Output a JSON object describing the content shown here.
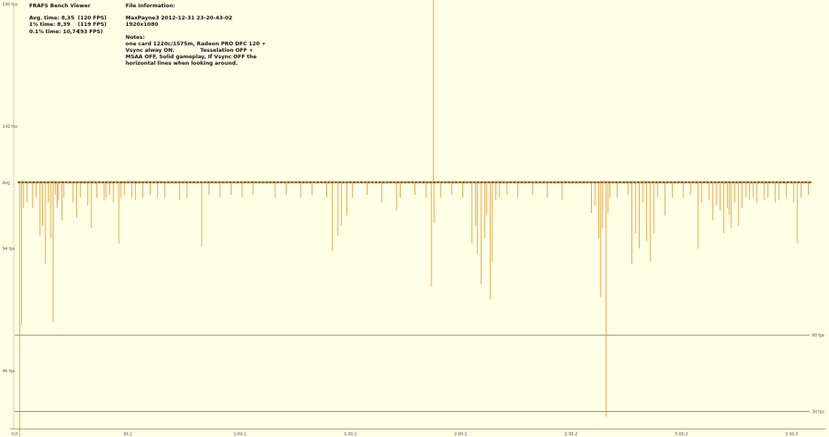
{
  "app": {
    "title": "FRAFS Bench Viewer",
    "stats": [
      {
        "label": "Avg. time: 8,35",
        "fps": "(120 FPS)"
      },
      {
        "label": "1% time: 8,39",
        "fps": "(119 FPS)"
      },
      {
        "label": "0.1% time: 10,74",
        "fps": "(93 FPS)"
      }
    ]
  },
  "file_info": {
    "heading": "File Information:",
    "name": "MaxPayne3 2012-12-31 23-20-43-02",
    "resolution": "1920x1080",
    "notes_heading": "Notes:",
    "notes_lines": [
      "one card 1220c/1575m, Radeon PRO DFC 120 +",
      "Vsync alway ON.              Tesselation OFF +",
      "MSAA OFF, Solid gameplay, If Vsync OFF the",
      "horizontal lines when looking around."
    ]
  },
  "colors": {
    "background": "#ffffe6",
    "trace": "#e8a23a",
    "line": "#6b6046",
    "avg": "#2b2b2b"
  },
  "chart_data": {
    "type": "line",
    "title": "",
    "xlabel": "",
    "ylabel": "",
    "ylim": [
      20,
      190
    ],
    "xlim": [
      0,
      216
    ],
    "y_tick_labels": [
      {
        "value": 190,
        "label": "190 fps"
      },
      {
        "value": 142,
        "label": "142 fps"
      },
      {
        "value": 120,
        "label": "Avg."
      },
      {
        "value": 94,
        "label": "94 fps"
      },
      {
        "value": 46,
        "label": "46 fps"
      }
    ],
    "x_tick_labels": [
      {
        "value": 0,
        "label": "0,0"
      },
      {
        "value": 30,
        "label": "30,1"
      },
      {
        "value": 60,
        "label": "1:00,1"
      },
      {
        "value": 90,
        "label": "1:30,1"
      },
      {
        "value": 120,
        "label": "2:00,1"
      },
      {
        "value": 150,
        "label": "2:30,2"
      },
      {
        "value": 180,
        "label": "3:00,3"
      },
      {
        "value": 210,
        "label": "3:30,3"
      }
    ],
    "reference_lines": [
      {
        "value": 60,
        "label": "60 fps"
      },
      {
        "value": 30,
        "label": "30 fps"
      }
    ],
    "series": [
      {
        "baseline": 120,
        "dips": [
          [
            0.5,
            18
          ],
          [
            1.0,
            64
          ],
          [
            1.5,
            110
          ],
          [
            2.5,
            112
          ],
          [
            4.0,
            110
          ],
          [
            5.0,
            114
          ],
          [
            6.0,
            99
          ],
          [
            6.7,
            103
          ],
          [
            7.5,
            88
          ],
          [
            8.3,
            112
          ],
          [
            9.0,
            98
          ],
          [
            9.6,
            65
          ],
          [
            10.2,
            115
          ],
          [
            10.7,
            110
          ],
          [
            11.0,
            113
          ],
          [
            12.0,
            105
          ],
          [
            12.5,
            114
          ],
          [
            15.0,
            112
          ],
          [
            16.0,
            106
          ],
          [
            17.0,
            114
          ],
          [
            19.0,
            111
          ],
          [
            20.0,
            102
          ],
          [
            21.5,
            114
          ],
          [
            23.5,
            113
          ],
          [
            24.0,
            114
          ],
          [
            25.0,
            115
          ],
          [
            26.0,
            112
          ],
          [
            27.5,
            96
          ],
          [
            28.0,
            114
          ],
          [
            29.0,
            115
          ],
          [
            31.0,
            114
          ],
          [
            32.0,
            113
          ],
          [
            34.0,
            114
          ],
          [
            36.0,
            115
          ],
          [
            38.0,
            114
          ],
          [
            40.0,
            114
          ],
          [
            44.0,
            113
          ],
          [
            46.0,
            114
          ],
          [
            50.0,
            95
          ],
          [
            52.0,
            115
          ],
          [
            55.0,
            114
          ],
          [
            58.0,
            115
          ],
          [
            61.0,
            114
          ],
          [
            64.0,
            115
          ],
          [
            70.0,
            114
          ],
          [
            73.0,
            115
          ],
          [
            77.0,
            114
          ],
          [
            80.0,
            115
          ],
          [
            84.0,
            114
          ],
          [
            85.5,
            93
          ],
          [
            87.0,
            99
          ],
          [
            88.0,
            103
          ],
          [
            89.5,
            107
          ],
          [
            91.0,
            114
          ],
          [
            95.0,
            115
          ],
          [
            99.0,
            112
          ],
          [
            103.0,
            109
          ],
          [
            104.0,
            114
          ],
          [
            108.0,
            115
          ],
          [
            111.0,
            114
          ],
          [
            112.5,
            79
          ],
          [
            113.0,
            192
          ],
          [
            113.2,
            104
          ],
          [
            115.0,
            114
          ],
          [
            118.0,
            115
          ],
          [
            121.0,
            114
          ],
          [
            123.5,
            96
          ],
          [
            124.5,
            103
          ],
          [
            125.0,
            92
          ],
          [
            126.0,
            80
          ],
          [
            127.0,
            98
          ],
          [
            127.5,
            107
          ],
          [
            128.5,
            74
          ],
          [
            129.0,
            89
          ],
          [
            130.0,
            113
          ],
          [
            131.0,
            114
          ],
          [
            133.0,
            115
          ],
          [
            136.0,
            114
          ],
          [
            140.0,
            115
          ],
          [
            144.0,
            114
          ],
          [
            148.0,
            113
          ],
          [
            156.0,
            108
          ],
          [
            157.0,
            111
          ],
          [
            158.0,
            98
          ],
          [
            158.5,
            75
          ],
          [
            159.0,
            102
          ],
          [
            160.0,
            28
          ],
          [
            160.5,
            108
          ],
          [
            161.0,
            114
          ],
          [
            163.0,
            114
          ],
          [
            166.0,
            115
          ],
          [
            167.0,
            88
          ],
          [
            168.0,
            100
          ],
          [
            169.0,
            94
          ],
          [
            170.0,
            112
          ],
          [
            171.0,
            97
          ],
          [
            172.0,
            89
          ],
          [
            173.0,
            100
          ],
          [
            174.0,
            114
          ],
          [
            176.0,
            107
          ],
          [
            178.0,
            114
          ],
          [
            181.0,
            114
          ],
          [
            183.0,
            115
          ],
          [
            185.0,
            94
          ],
          [
            186.0,
            112
          ],
          [
            188.0,
            113
          ],
          [
            189.0,
            105
          ],
          [
            190.0,
            111
          ],
          [
            191.0,
            109
          ],
          [
            192.0,
            100
          ],
          [
            193.0,
            110
          ],
          [
            193.5,
            107
          ],
          [
            194.0,
            102
          ],
          [
            195.0,
            112
          ],
          [
            196.0,
            103
          ],
          [
            197.0,
            110
          ],
          [
            198.0,
            114
          ],
          [
            199.0,
            113
          ],
          [
            200.0,
            114
          ],
          [
            201.0,
            112
          ],
          [
            203.0,
            113
          ],
          [
            204.0,
            114
          ],
          [
            206.0,
            112
          ],
          [
            207.0,
            113
          ],
          [
            209.0,
            114
          ],
          [
            211.0,
            112
          ],
          [
            212.0,
            96
          ],
          [
            213.0,
            114
          ],
          [
            215.0,
            115
          ]
        ]
      }
    ],
    "grid": false,
    "legend": "none"
  }
}
